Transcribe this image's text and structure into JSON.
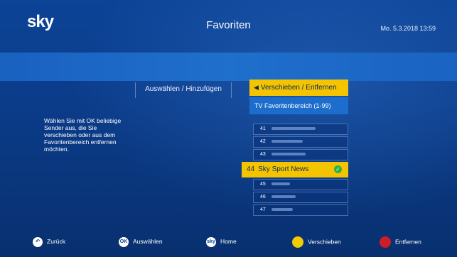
{
  "header": {
    "logo_text": "sky",
    "title": "Favoriten",
    "datetime": "Mo. 5.3.2018  13:59"
  },
  "tabs": {
    "left_label": "Auswählen / Hinzufügen",
    "active_label": "Verschieben / Entfernen",
    "active_arrow": "◀"
  },
  "range_label": "TV Favoritenbereich (1-99)",
  "help_text": "Wählen Sie mit OK beliebige Sender aus, die Sie verschieben oder aus dem Favoritenbereich entfernen möchten.",
  "channels": [
    {
      "num": "41",
      "name": "",
      "blurred": true
    },
    {
      "num": "42",
      "name": "",
      "blurred": true
    },
    {
      "num": "43",
      "name": "",
      "blurred": true
    },
    {
      "num": "44",
      "name": "Sky Sport News",
      "selected": true,
      "check_icon": "check-circle-icon"
    },
    {
      "num": "45",
      "name": "",
      "blurred": true
    },
    {
      "num": "46",
      "name": "",
      "blurred": true
    },
    {
      "num": "47",
      "name": "",
      "blurred": true
    }
  ],
  "footer": {
    "back": {
      "icon": "back-icon",
      "label": "Zurück"
    },
    "select": {
      "icon": "ok-icon",
      "icon_text": "OK",
      "label": "Auswählen"
    },
    "home": {
      "icon": "sky-home-icon",
      "icon_text": "sky",
      "label": "Home"
    },
    "move": {
      "icon": "yellow-button-icon",
      "label": "Verschieben",
      "color": "#f1cc00"
    },
    "remove": {
      "icon": "red-button-icon",
      "label": "Entfernen",
      "color": "#cf1d27"
    }
  },
  "colors": {
    "accent_yellow": "#f5c400",
    "highlight_blue": "#1c6dcc",
    "background_blue": "#0b3f8f"
  }
}
